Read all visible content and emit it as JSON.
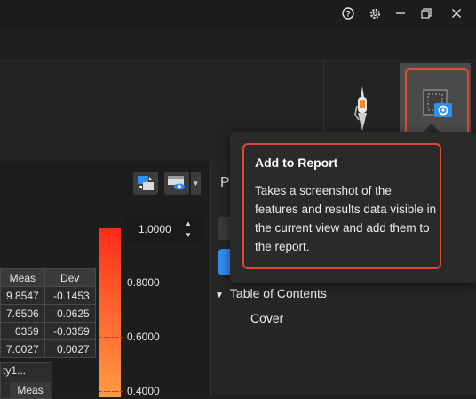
{
  "window_controls": {
    "help": "help-icon",
    "settings": "gear-icon",
    "minimize": "minimize-icon",
    "restore": "restore-icon",
    "close": "close-icon"
  },
  "ribbon": {
    "tools": [
      "pen-tool-icon",
      "add-to-report-icon"
    ]
  },
  "tooltip": {
    "title": "Add to Report",
    "description": "Takes a screenshot of the features and results data visible in the current view and add them to the report."
  },
  "viewport": {
    "colorbar": {
      "top_value": "1.0000",
      "labels": [
        "0.8000",
        "0.6000",
        "0.4000"
      ]
    },
    "table": {
      "headers": [
        "Meas",
        "Dev"
      ],
      "rows": [
        [
          "9.8547",
          "-0.1453"
        ],
        [
          "7.6506",
          "0.0625"
        ],
        [
          "0359",
          "-0.0359"
        ],
        [
          "7.0027",
          "0.0027"
        ]
      ]
    },
    "table2": {
      "title": "ty1...",
      "header": "Meas"
    }
  },
  "panel": {
    "title_fragment": "P",
    "toc_label": "Table of Contents",
    "cover_label": "Cover"
  },
  "colors": {
    "accent_blue": "#2f8ff0",
    "highlight_red": "#e04834"
  }
}
